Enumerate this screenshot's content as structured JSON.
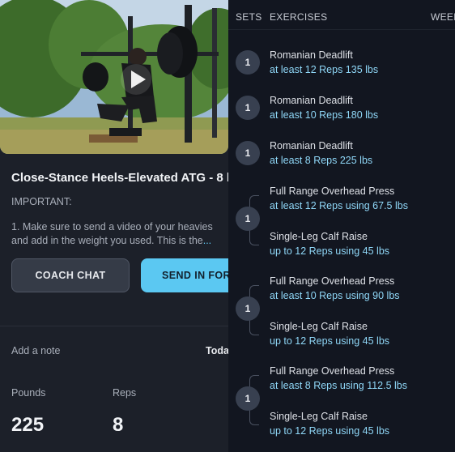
{
  "workout": {
    "title": "Close-Stance Heels-Elevated ATG - 8 l",
    "important_label": "IMPORTANT:",
    "description_lines": [
      "1. Make sure to send a video of your heavies",
      "and add in the weight you used. This is the"
    ],
    "more_indicator": "...",
    "coach_chat_label": "COACH CHAT",
    "send_in_form_label": "SEND IN FOR",
    "add_note_label": "Add a note",
    "today_label": "Toda",
    "pounds_label": "Pounds",
    "reps_label": "Reps",
    "pounds_value": "225",
    "reps_value": "8"
  },
  "columns": {
    "sets": "SETS",
    "exercises": "EXERCISES",
    "week": "WEEK"
  },
  "plan": [
    {
      "sets": "1",
      "exercises": [
        {
          "name": "Romanian Deadlift",
          "detail": "at least 12 Reps 135 lbs"
        }
      ]
    },
    {
      "sets": "1",
      "exercises": [
        {
          "name": "Romanian Deadlift",
          "detail": "at least 10 Reps 180 lbs"
        }
      ]
    },
    {
      "sets": "1",
      "exercises": [
        {
          "name": "Romanian Deadlift",
          "detail": "at least 8 Reps 225 lbs"
        }
      ]
    },
    {
      "sets": "1",
      "exercises": [
        {
          "name": "Full Range Overhead Press",
          "detail": "at least 12 Reps using 67.5 lbs"
        },
        {
          "name": "Single-Leg Calf Raise",
          "detail": "up to 12 Reps using 45 lbs"
        }
      ]
    },
    {
      "sets": "1",
      "exercises": [
        {
          "name": "Full Range Overhead Press",
          "detail": "at least 10 Reps using 90 lbs"
        },
        {
          "name": "Single-Leg Calf Raise",
          "detail": "up to 12 Reps using 45 lbs"
        }
      ]
    },
    {
      "sets": "1",
      "exercises": [
        {
          "name": "Full Range Overhead Press",
          "detail": "at least 8 Reps using 112.5 lbs"
        },
        {
          "name": "Single-Leg Calf Raise",
          "detail": "up to 12 Reps using 45 lbs"
        }
      ]
    }
  ],
  "icons": {
    "play": "play-icon"
  },
  "colors": {
    "accent": "#5bc8f2",
    "detail_text": "#8fd7f7",
    "panel_left": "#1c2029",
    "panel_right": "#121620",
    "badge": "#384050"
  }
}
